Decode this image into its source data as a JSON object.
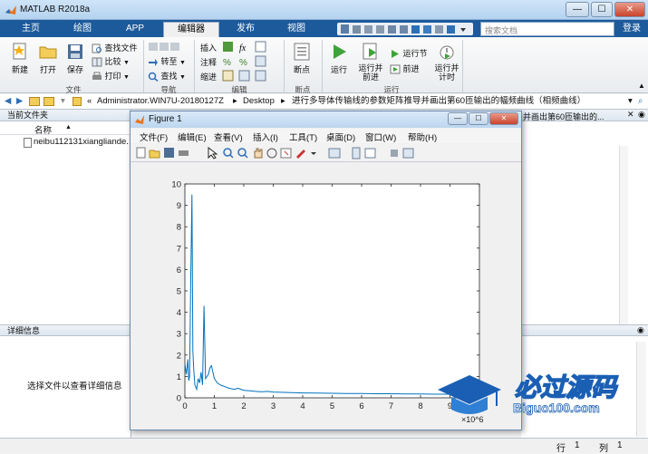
{
  "window": {
    "title": "MATLAB R2018a",
    "min": "—",
    "max": "☐",
    "close": "✕"
  },
  "tabs": [
    {
      "label": "主页"
    },
    {
      "label": "绘图"
    },
    {
      "label": "APP"
    },
    {
      "label": "编辑器"
    },
    {
      "label": "发布"
    },
    {
      "label": "视图"
    }
  ],
  "search": {
    "placeholder": "搜索文档"
  },
  "login": "登录",
  "ribbon": {
    "file": {
      "new": "新建",
      "open": "打开",
      "save": "保存",
      "find_files": "查找文件",
      "compare": "比较",
      "print": "打印",
      "group": "文件"
    },
    "nav": {
      "goto": "转至",
      "find": "查找",
      "group": "导航"
    },
    "edit": {
      "insert": "插入",
      "comment": "注释",
      "indent": "缩进",
      "fx": "fx",
      "group": "编辑"
    },
    "breakpoints": {
      "label": "断点",
      "group": "断点"
    },
    "run": {
      "run": "运行",
      "run_advance": "运行并\n前进",
      "run_section": "运行节",
      "advance": "前进",
      "run_time": "运行并\n计时",
      "group": "运行"
    }
  },
  "address": {
    "prefix": "«",
    "parts": [
      "Administrator.WIN7U-20180127Z",
      "Desktop",
      "进行多导体传输线的参数矩阵推导并画出第60匝输出的幅频曲线（相频曲线）"
    ],
    "sep": "▸"
  },
  "left_panel": {
    "title": "当前文件夹",
    "column": "名称",
    "sort": "▲",
    "files": [
      {
        "name": "neibu112131xiangliande..."
      }
    ],
    "details_title": "详细信息",
    "details_text": "选择文件以查看详细信息"
  },
  "right_panel": {
    "tab_text": "并画出第60匝输出的..."
  },
  "figure": {
    "title": "Figure 1",
    "menu": [
      "文件(F)",
      "编辑(E)",
      "查看(V)",
      "插入(I)",
      "工具(T)",
      "桌面(D)",
      "窗口(W)",
      "帮助(H)"
    ]
  },
  "status": {
    "row_label": "行",
    "row": "1",
    "col_label": "列",
    "col": "1"
  },
  "watermark": {
    "brand": "必过源码",
    "url": "Biguo100.com"
  },
  "colors": {
    "accent": "#1c5a9c",
    "plot_line": "#0072BD"
  },
  "chart_data": {
    "type": "line",
    "xlim": [
      0,
      10
    ],
    "ylim": [
      0,
      10
    ],
    "x_exponent": "×10^6",
    "x_ticks": [
      0,
      1,
      2,
      3,
      4,
      5,
      6,
      7,
      8,
      9,
      10
    ],
    "y_ticks": [
      0,
      1,
      2,
      3,
      4,
      5,
      6,
      7,
      8,
      9,
      10
    ],
    "grid": false,
    "series": [
      {
        "x": [
          0,
          0.05,
          0.1,
          0.13,
          0.16,
          0.2,
          0.24,
          0.27,
          0.3,
          0.34,
          0.4,
          0.45,
          0.5,
          0.55,
          0.6,
          0.65,
          0.7,
          0.75,
          0.8,
          0.85,
          0.9,
          0.95,
          1.0,
          1.05,
          1.1,
          1.2,
          1.3,
          1.4,
          1.5,
          1.6,
          1.7,
          1.8,
          1.9,
          2.0,
          2.2,
          2.4,
          2.6,
          2.8,
          3.0,
          3.5,
          4.0,
          4.5,
          5.0,
          5.5,
          6.0,
          6.5,
          7.0,
          7.5,
          8.0,
          8.5,
          9.0,
          9.5,
          9.8
        ],
        "y": [
          1.6,
          1.1,
          1.8,
          0.8,
          1.0,
          5.6,
          9.5,
          2.2,
          1.3,
          0.6,
          0.4,
          0.9,
          0.7,
          1.2,
          0.6,
          4.3,
          0.9,
          1.0,
          1.1,
          1.4,
          1.5,
          1.2,
          0.9,
          0.8,
          0.7,
          0.6,
          0.55,
          0.5,
          0.45,
          0.42,
          0.4,
          0.45,
          0.4,
          0.35,
          0.33,
          0.3,
          0.28,
          0.3,
          0.27,
          0.25,
          0.23,
          0.22,
          0.21,
          0.2,
          0.2,
          0.19,
          0.19,
          0.18,
          0.18,
          0.17,
          0.17,
          0.16,
          0.16
        ]
      }
    ]
  }
}
